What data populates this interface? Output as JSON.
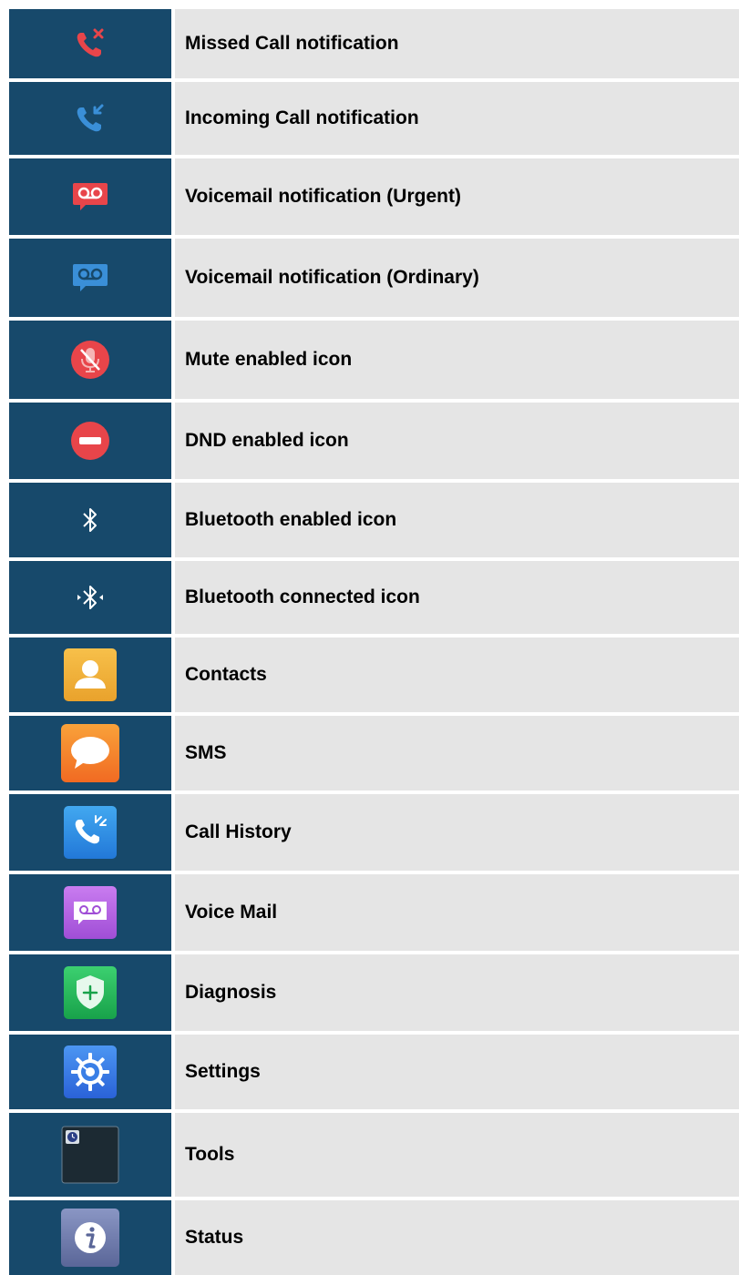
{
  "colors": {
    "icon_cell_bg": "#17496b",
    "text_cell_bg": "#e5e5e5",
    "missed_red": "#e8454a",
    "incoming_blue": "#3a8fd8",
    "voicemail_urgent_red": "#e8454a",
    "voicemail_ordinary_blue": "#3a8fd8",
    "mute_red": "#e8454a",
    "dnd_red": "#e8454a",
    "bluetooth_white": "#ffffff",
    "contacts_orange": "#f0b23c",
    "sms_orange": "#f6862a",
    "call_history_blue": "#2f8ee6",
    "voice_mail_purple": "#b463e0",
    "diagnosis_green": "#22b45a",
    "settings_blue": "#3a7fe6",
    "tools_dark": "#1c2a33",
    "status_gray": "#6b78a8"
  },
  "rows": [
    {
      "icon": "missed-call-icon",
      "label": "Missed Call notification"
    },
    {
      "icon": "incoming-call-icon",
      "label": "Incoming Call notification"
    },
    {
      "icon": "voicemail-urgent-icon",
      "label": "Voicemail notification (Urgent)"
    },
    {
      "icon": "voicemail-ordinary-icon",
      "label": "Voicemail notification (Ordinary)"
    },
    {
      "icon": "mute-icon",
      "label": "Mute enabled icon"
    },
    {
      "icon": "dnd-icon",
      "label": "DND enabled icon"
    },
    {
      "icon": "bluetooth-enabled-icon",
      "label": "Bluetooth enabled icon"
    },
    {
      "icon": "bluetooth-connected-icon",
      "label": "Bluetooth connected icon"
    },
    {
      "icon": "contacts-app-icon",
      "label": "Contacts"
    },
    {
      "icon": "sms-app-icon",
      "label": "SMS"
    },
    {
      "icon": "call-history-app-icon",
      "label": "Call History"
    },
    {
      "icon": "voice-mail-app-icon",
      "label": "Voice Mail"
    },
    {
      "icon": "diagnosis-app-icon",
      "label": "Diagnosis"
    },
    {
      "icon": "settings-app-icon",
      "label": "Settings"
    },
    {
      "icon": "tools-app-icon",
      "label": "Tools"
    },
    {
      "icon": "status-app-icon",
      "label": "Status"
    }
  ]
}
